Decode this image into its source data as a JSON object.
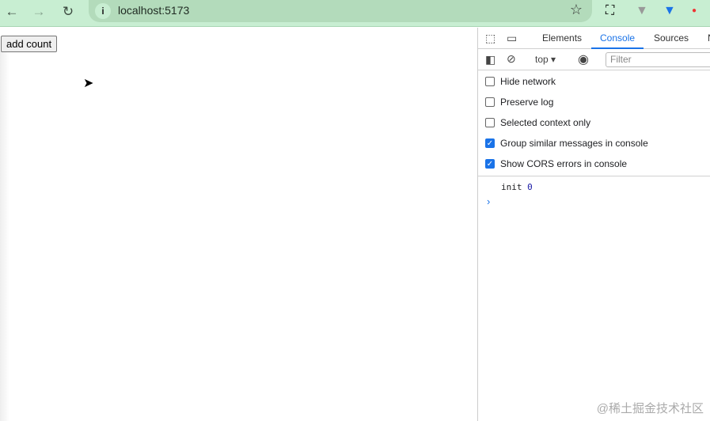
{
  "browser": {
    "url": "localhost:5173"
  },
  "page": {
    "add_count_label": "add count"
  },
  "devtools": {
    "tabs": [
      "Elements",
      "Console",
      "Sources",
      "N"
    ],
    "active_tab": "Console",
    "context": "top",
    "filter_placeholder": "Filter",
    "settings": [
      {
        "label": "Hide network",
        "checked": false
      },
      {
        "label": "Preserve log",
        "checked": false
      },
      {
        "label": "Selected context only",
        "checked": false
      },
      {
        "label": "Group similar messages in console",
        "checked": true
      },
      {
        "label": "Show CORS errors in console",
        "checked": true
      }
    ],
    "log": {
      "text": "init",
      "value": "0"
    }
  },
  "watermark": "@稀土掘金技术社区",
  "colors": {
    "accent": "#1a73e8",
    "toolbar": "#c8eed2"
  }
}
